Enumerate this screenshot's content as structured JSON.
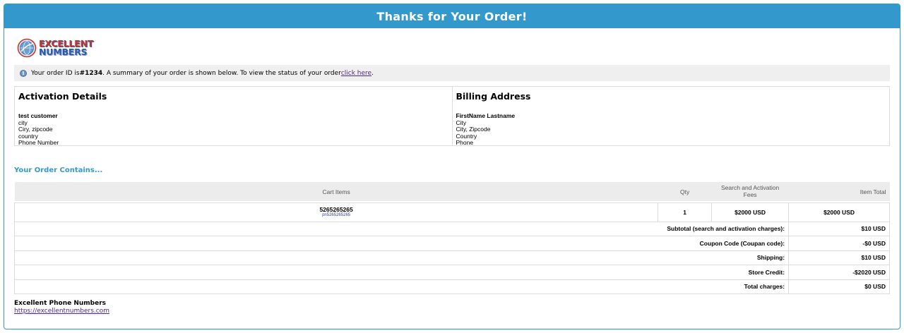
{
  "header": {
    "title": "Thanks for Your Order!"
  },
  "logo": {
    "line1": "EXCELLENT",
    "line2": "NUMBERS"
  },
  "notice": {
    "prefix": "Your order ID is ",
    "order_id": "#1234",
    "middle": ". A summary of your order is shown below. To view the status of your order ",
    "link_text": "click here",
    "suffix": "."
  },
  "activation": {
    "heading": "Activation Details",
    "name": "test customer",
    "lines": [
      "city",
      "Ciry, zipcode",
      "country",
      "Phone Number"
    ]
  },
  "billing": {
    "heading": "Billing Address",
    "name": "FirstName Lastname",
    "lines": [
      "City",
      "City, Zipcode",
      "Country",
      "Phone"
    ]
  },
  "order": {
    "heading": "Your Order Contains...",
    "columns": {
      "cart": "Cart Items",
      "qty": "Qty",
      "fees": "Search and Activation Fees",
      "total": "Item Total"
    },
    "item": {
      "number": "5265265265",
      "sub": "pn5265265265",
      "qty": "1",
      "fees": "$2000 USD",
      "total": "$2000 USD"
    },
    "summary": [
      {
        "label": "Subtotal (search and activation charges):",
        "value": "$10 USD"
      },
      {
        "label": "Coupon Code (Coupan code):",
        "value": "-$0 USD"
      },
      {
        "label": "Shipping:",
        "value": "$10 USD"
      },
      {
        "label": "Store Credit:",
        "value": "-$2020 USD"
      },
      {
        "label": "Total charges:",
        "value": "$0 USD"
      }
    ]
  },
  "footer": {
    "company": "Excellent Phone Numbers",
    "url": "https://excellentnumbers.com"
  },
  "colors": {
    "accent": "#3399cc",
    "link": "#4a2a8a",
    "panel": "#efefef"
  }
}
